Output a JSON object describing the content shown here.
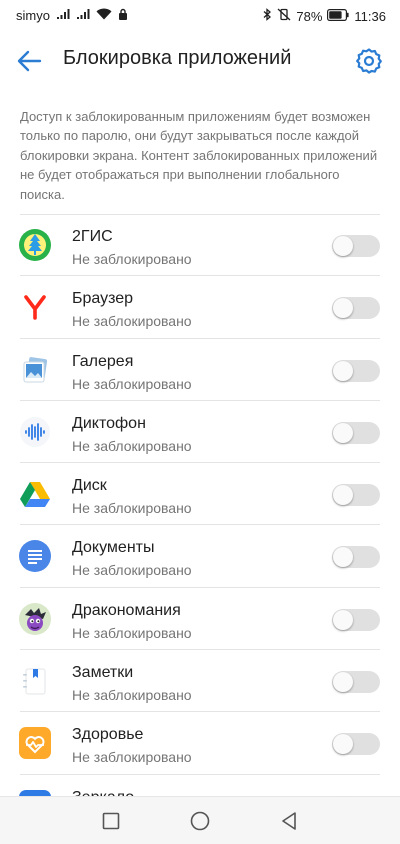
{
  "status_bar": {
    "carrier": "simyo",
    "battery": "78%",
    "time": "11:36",
    "icons": [
      "sim-signal-icon",
      "signal-icon",
      "wifi-icon",
      "lock-icon",
      "bluetooth-icon",
      "vibrate-off-icon",
      "battery-icon"
    ]
  },
  "header": {
    "title": "Блокировка приложений",
    "back_icon": "back-arrow-icon",
    "settings_icon": "gear-icon"
  },
  "description": "Доступ к заблокированным приложениям будет возможен только по паролю, они будут закрываться после каждой блокировки экрана. Контент заблокированных приложений не будет отображаться при выполнении глобального поиска.",
  "apps": [
    {
      "name": "2ГИС",
      "status": "Не заблокировано",
      "locked": false,
      "icon": "2gis-icon"
    },
    {
      "name": "Браузер",
      "status": "Не заблокировано",
      "locked": false,
      "icon": "yandex-browser-icon"
    },
    {
      "name": "Галерея",
      "status": "Не заблокировано",
      "locked": false,
      "icon": "gallery-icon"
    },
    {
      "name": "Диктофон",
      "status": "Не заблокировано",
      "locked": false,
      "icon": "recorder-icon"
    },
    {
      "name": "Диск",
      "status": "Не заблокировано",
      "locked": false,
      "icon": "drive-icon"
    },
    {
      "name": "Документы",
      "status": "Не заблокировано",
      "locked": false,
      "icon": "docs-icon"
    },
    {
      "name": "Дракономания",
      "status": "Не заблокировано",
      "locked": false,
      "icon": "dragon-game-icon"
    },
    {
      "name": "Заметки",
      "status": "Не заблокировано",
      "locked": false,
      "icon": "notes-icon"
    },
    {
      "name": "Здоровье",
      "status": "Не заблокировано",
      "locked": false,
      "icon": "health-icon"
    },
    {
      "name": "Зеркало",
      "status": "",
      "locked": false,
      "icon": "mirror-icon"
    }
  ],
  "nav": {
    "icons": [
      "recent-apps-icon",
      "home-icon",
      "back-triangle-icon"
    ]
  },
  "colors": {
    "accent": "#2b7cd3",
    "text_primary": "#212121",
    "text_secondary": "#757575",
    "toggle_off": "#e0e0e0"
  }
}
